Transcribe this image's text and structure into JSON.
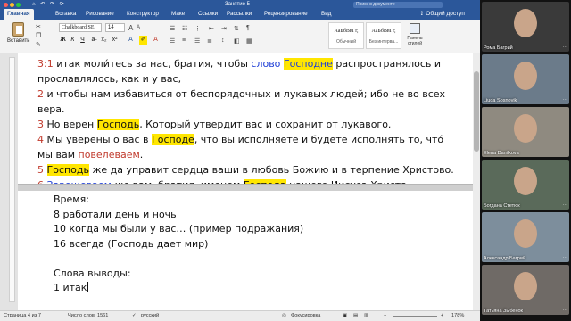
{
  "window": {
    "title": "Занятие 5",
    "search_placeholder": "Поиск в документе",
    "quick_access": "⌂ ↶ ↷ ⟳"
  },
  "ribbon_tabs": [
    {
      "label": "Главная",
      "active": true
    },
    {
      "label": "Вставка"
    },
    {
      "label": "Рисование"
    },
    {
      "label": "Конструктор"
    },
    {
      "label": "Макет"
    },
    {
      "label": "Ссылки"
    },
    {
      "label": "Рассылки"
    },
    {
      "label": "Рецензирование"
    },
    {
      "label": "Вид"
    }
  ],
  "share_label": "Общий доступ",
  "ribbon": {
    "paste_label": "Вставить",
    "font_name": "Chalkboard SE",
    "font_size": "14",
    "style_normal_sample": "АаБбВвГг,",
    "style_normal_label": "Обычный",
    "style_nospacing_sample": "АаБбВвГг,",
    "style_nospacing_label": "Без интерва...",
    "styles_pane_label": "Панель стилей",
    "bold": "Ж",
    "italic": "К",
    "underline": "Ч",
    "grow_font": "A",
    "shrink_font": "A"
  },
  "document": {
    "verses": [
      {
        "num": "3:1",
        "parts": [
          {
            "t": " итак моли́тесь за нас, братия, чтобы "
          },
          {
            "t": "слово ",
            "c": "blue"
          },
          {
            "t": "Господне",
            "c": "blue",
            "hl": true
          },
          {
            "t": " распространялось и"
          }
        ]
      },
      {
        "num": "",
        "parts": [
          {
            "t": "прославлялось, как и у вас,"
          }
        ]
      },
      {
        "num": "2",
        "parts": [
          {
            "t": " и чтобы нам избавиться от беспорядочных и лукавых людей; ибо не во всех"
          }
        ]
      },
      {
        "num": "",
        "parts": [
          {
            "t": "вера."
          }
        ]
      },
      {
        "num": "3",
        "parts": [
          {
            "t": " Но верен "
          },
          {
            "t": "Господь",
            "hl": true
          },
          {
            "t": ", Который утвердит вас и сохранит от лукавого."
          }
        ]
      },
      {
        "num": "4",
        "parts": [
          {
            "t": " Мы уверены о вас в "
          },
          {
            "t": "Господе",
            "hl": true
          },
          {
            "t": ", что вы исполняете и будете исполнять то, что́"
          }
        ]
      },
      {
        "num": "",
        "parts": [
          {
            "t": "мы вам "
          },
          {
            "t": "повелеваем",
            "c": "pink"
          },
          {
            "t": "."
          }
        ]
      },
      {
        "num": "5",
        "parts": [
          {
            "t": " "
          },
          {
            "t": "Господь",
            "hl": true
          },
          {
            "t": " же да управит сердца ваши в любовь Божию и в терпение Христово."
          }
        ]
      },
      {
        "num": "6",
        "parts": [
          {
            "t": " "
          },
          {
            "t": "Завещеваем",
            "c": "blue"
          },
          {
            "t": " же вам, братия, именем "
          },
          {
            "t": "Господа",
            "hl": true
          },
          {
            "t": " нашего Иисуса Христа,"
          }
        ]
      }
    ],
    "notes": [
      "Время:",
      "8 работали день и ночь",
      "10 когда мы были у вас… (пример подражания)",
      "16 всегда (Господь дает мир)",
      "",
      "Слова выводы:",
      "1 итак"
    ]
  },
  "status_bar": {
    "page": "Страница 4 из 7",
    "words": "Число слов: 1561",
    "language": "русский",
    "focus": "Фокусировка",
    "zoom": "178%"
  },
  "participants": [
    {
      "name": "Рома Багрий",
      "bg": "#3a3a3a"
    },
    {
      "name": "Liuda Sosnovik",
      "bg": "#6b7b8a"
    },
    {
      "name": "Elena Danilkova",
      "bg": "#8f8a80"
    },
    {
      "name": "Богдана Стетюк",
      "bg": "#5a6a5a"
    },
    {
      "name": "Александр Багрий",
      "bg": "#7d8e9c"
    },
    {
      "name": "Татьяна Зыбенок",
      "bg": "#6f6a66"
    }
  ]
}
